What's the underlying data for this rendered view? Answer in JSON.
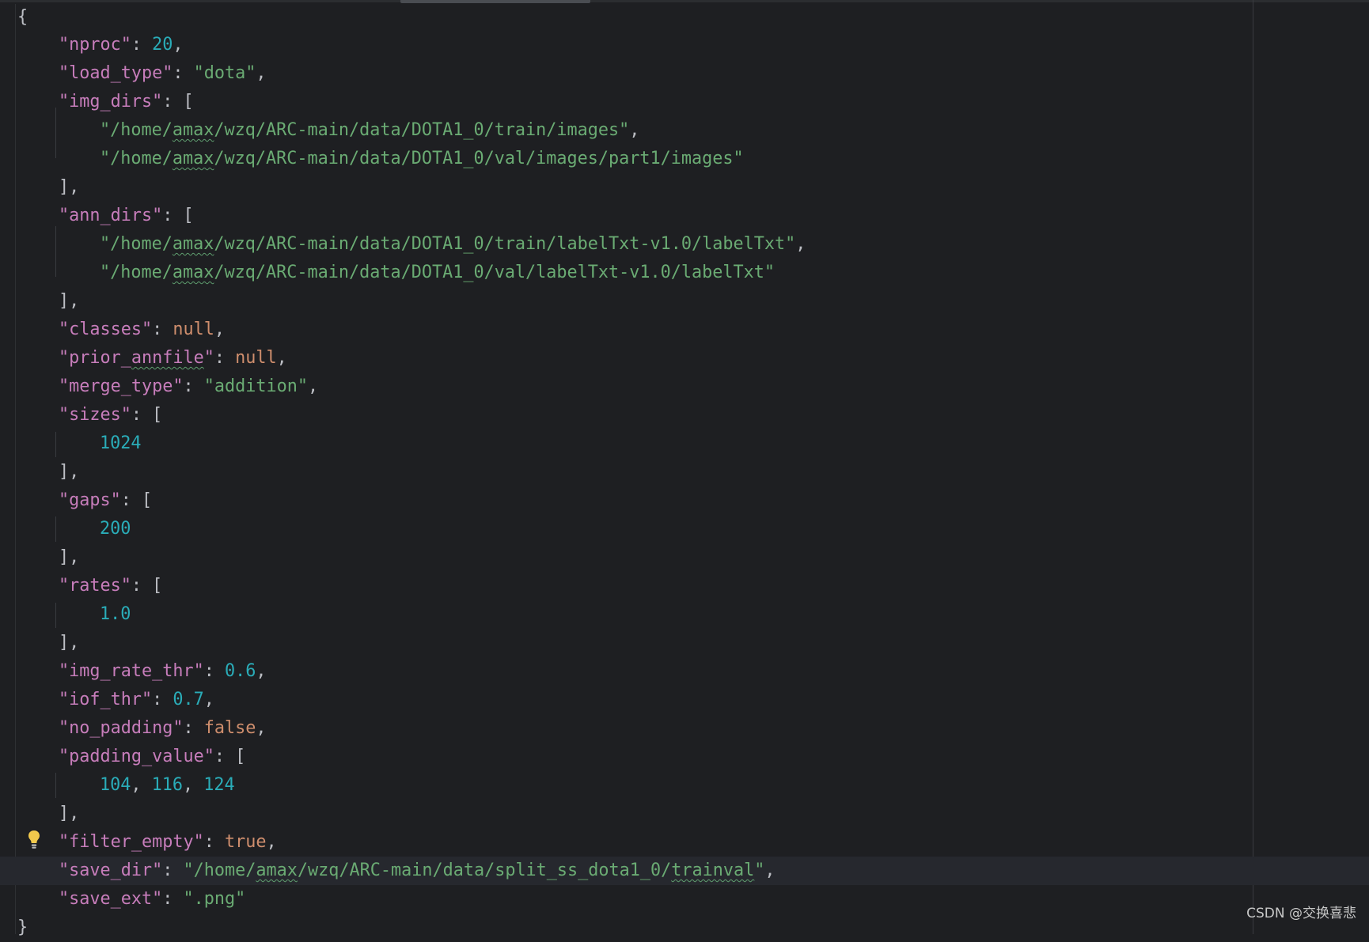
{
  "editor": {
    "language": "json",
    "lines": {
      "l01_open": "{",
      "l02_key": "\"nproc\"",
      "l02_val": "20",
      "l03_key": "\"load_type\"",
      "l03_val": "\"dota\"",
      "l04_key": "\"img_dirs\"",
      "l05_a": "\"/home/",
      "l05_b": "amax",
      "l05_c": "/wzq/ARC-main/data/DOTA1_0/train/images\"",
      "l06_a": "\"/home/",
      "l06_b": "amax",
      "l06_c": "/wzq/ARC-main/data/DOTA1_0/val/images/part1/images\"",
      "l08_key": "\"ann_dirs\"",
      "l09_a": "\"/home/",
      "l09_b": "amax",
      "l09_c": "/wzq/ARC-main/data/DOTA1_0/train/labelTxt-v1.0/labelTxt\"",
      "l10_a": "\"/home/",
      "l10_b": "amax",
      "l10_c": "/wzq/ARC-main/data/DOTA1_0/val/labelTxt-v1.0/labelTxt\"",
      "l12_key": "\"classes\"",
      "l12_val": "null",
      "l13_key_a": "\"prior_",
      "l13_key_b": "annfile",
      "l13_key_c": "\"",
      "l13_val": "null",
      "l14_key": "\"merge_type\"",
      "l14_val": "\"addition\"",
      "l15_key": "\"sizes\"",
      "l16_val": "1024",
      "l18_key": "\"gaps\"",
      "l19_val": "200",
      "l21_key": "\"rates\"",
      "l22_val": "1.0",
      "l24_key": "\"img_rate_thr\"",
      "l24_val": "0.6",
      "l25_key": "\"iof_thr\"",
      "l25_val": "0.7",
      "l26_key": "\"no_padding\"",
      "l26_val": "false",
      "l27_key": "\"padding_value\"",
      "l28_v1": "104",
      "l28_v2": "116",
      "l28_v3": "124",
      "l30_key": "\"filter_empty\"",
      "l30_val": "true",
      "l31_key": "\"save_dir\"",
      "l31_a": "\"/home/",
      "l31_b": "amax",
      "l31_c": "/wzq/ARC-main/data/split_ss_dota1_0/",
      "l31_d": "trainval",
      "l31_e": "\"",
      "l32_key": "\"save_ext\"",
      "l32_val": "\".png\"",
      "l33_close": "}"
    },
    "intention_icon": "lightbulb-icon"
  },
  "watermark": "CSDN @交换喜悲",
  "colors": {
    "background": "#1e1f22",
    "key": "#c77dbb",
    "string": "#6aab73",
    "number": "#2aacb8",
    "keyword": "#cf8e6d",
    "punctuation": "#bcbec4"
  }
}
